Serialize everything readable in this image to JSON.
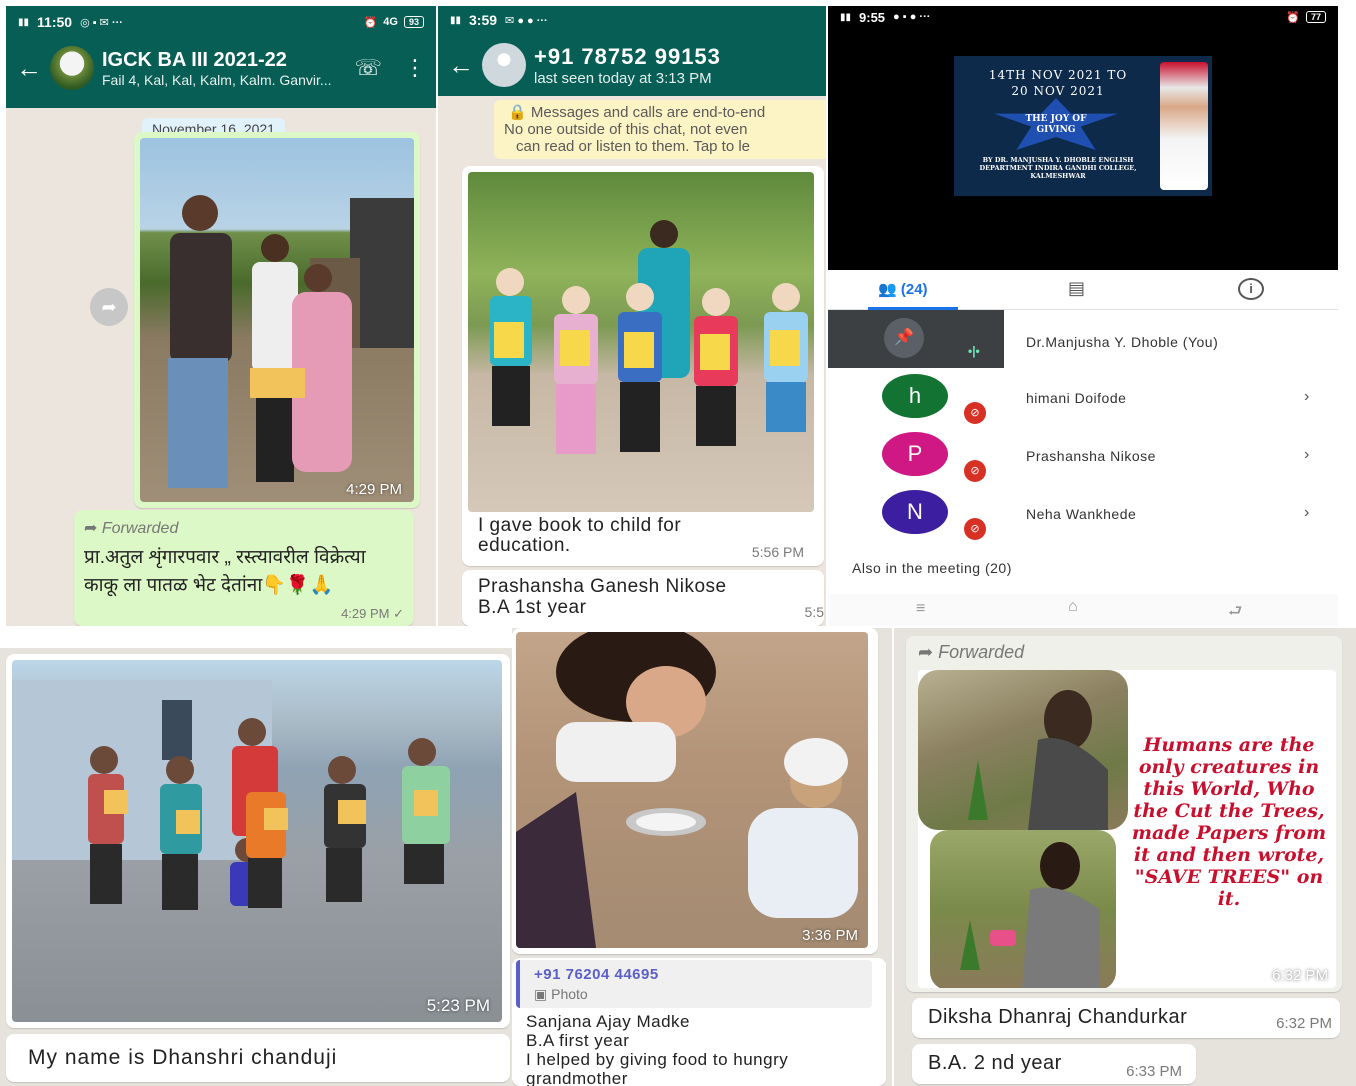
{
  "panel1": {
    "status_time": "11:50",
    "status_network": "4G",
    "status_battery": "93",
    "chat_title": "IGCK BA III 2021-22",
    "chat_subtitle": "Fail 4, Kal, Kal, Kalm, Kalm. Ganvir...",
    "date_chip": "November 16, 2021",
    "photo_time": "4:29 PM",
    "forwarded_label": "Forwarded",
    "message_text": "प्रा.अतुल शृंगारपवार „ रस्त्यावरील विक्रेत्या काकू ला पातळ भेट देतांना👇🌹🙏",
    "message_time": "4:29 PM ✓"
  },
  "panel2": {
    "status_time": "3:59",
    "contact_name": "+91 78752 99153",
    "last_seen": "last seen today at 3:13 PM",
    "encryption_line1": "Messages and calls are end-to-end",
    "encryption_line2": "No one outside of this chat, not even",
    "encryption_line3": "can read or listen to them. Tap to le",
    "caption": "I gave book to child for education.",
    "caption_time": "5:56 PM",
    "next_message": "Prashansha Ganesh Nikose\nB.A 1st year",
    "next_time": "5:5"
  },
  "panel3": {
    "status_time": "9:55",
    "status_battery": "77",
    "slide_line1": "14TH NOV 2021 TO",
    "slide_line2": "20 NOV 2021",
    "slide_badge": "THE JOY OF GIVING",
    "slide_credit": "BY DR. MANJUSHA Y. DHOBLE ENGLISH DEPARTMENT INDIRA GANDHI COLLEGE, KALMESHWAR",
    "tab_people_count": "(24)",
    "participants": [
      {
        "name": "Dr.Manjusha Y. Dhoble (You)"
      },
      {
        "initial": "h",
        "name": "himani Doifode",
        "color": "#137333"
      },
      {
        "initial": "P",
        "name": "Prashansha Nikose",
        "color": "#d01884"
      },
      {
        "initial": "N",
        "name": "Neha Wankhede",
        "color": "#3c1ea0"
      }
    ],
    "also_in_meeting": "Also in the meeting (20)"
  },
  "panel4": {
    "photo_time": "5:23 PM",
    "caption": "My name is Dhanshri chanduji"
  },
  "panel5": {
    "photo_time": "3:36 PM",
    "reply_sender": "+91 76204 44695",
    "reply_type": "Photo",
    "message": "Sanjana Ajay Madke\nB.A first year\nI helped by giving food to hungry\ngrandmother"
  },
  "panel6": {
    "forwarded_label": "Forwarded",
    "quote": "Humans are the only creatures in this World, Who the Cut the Trees, made Papers from it and then wrote, \"SAVE TREES\" on it.",
    "photo_time": "6:32 PM",
    "name_message": "Diksha Dhanraj Chandurkar",
    "name_time": "6:32 PM",
    "year_message": "B.A. 2 nd year",
    "year_time": "6:33 PM"
  },
  "colors": {
    "whatsapp_green": "#075e54",
    "bubble_out": "#dcf8c6",
    "meet_dark": "#202124"
  }
}
